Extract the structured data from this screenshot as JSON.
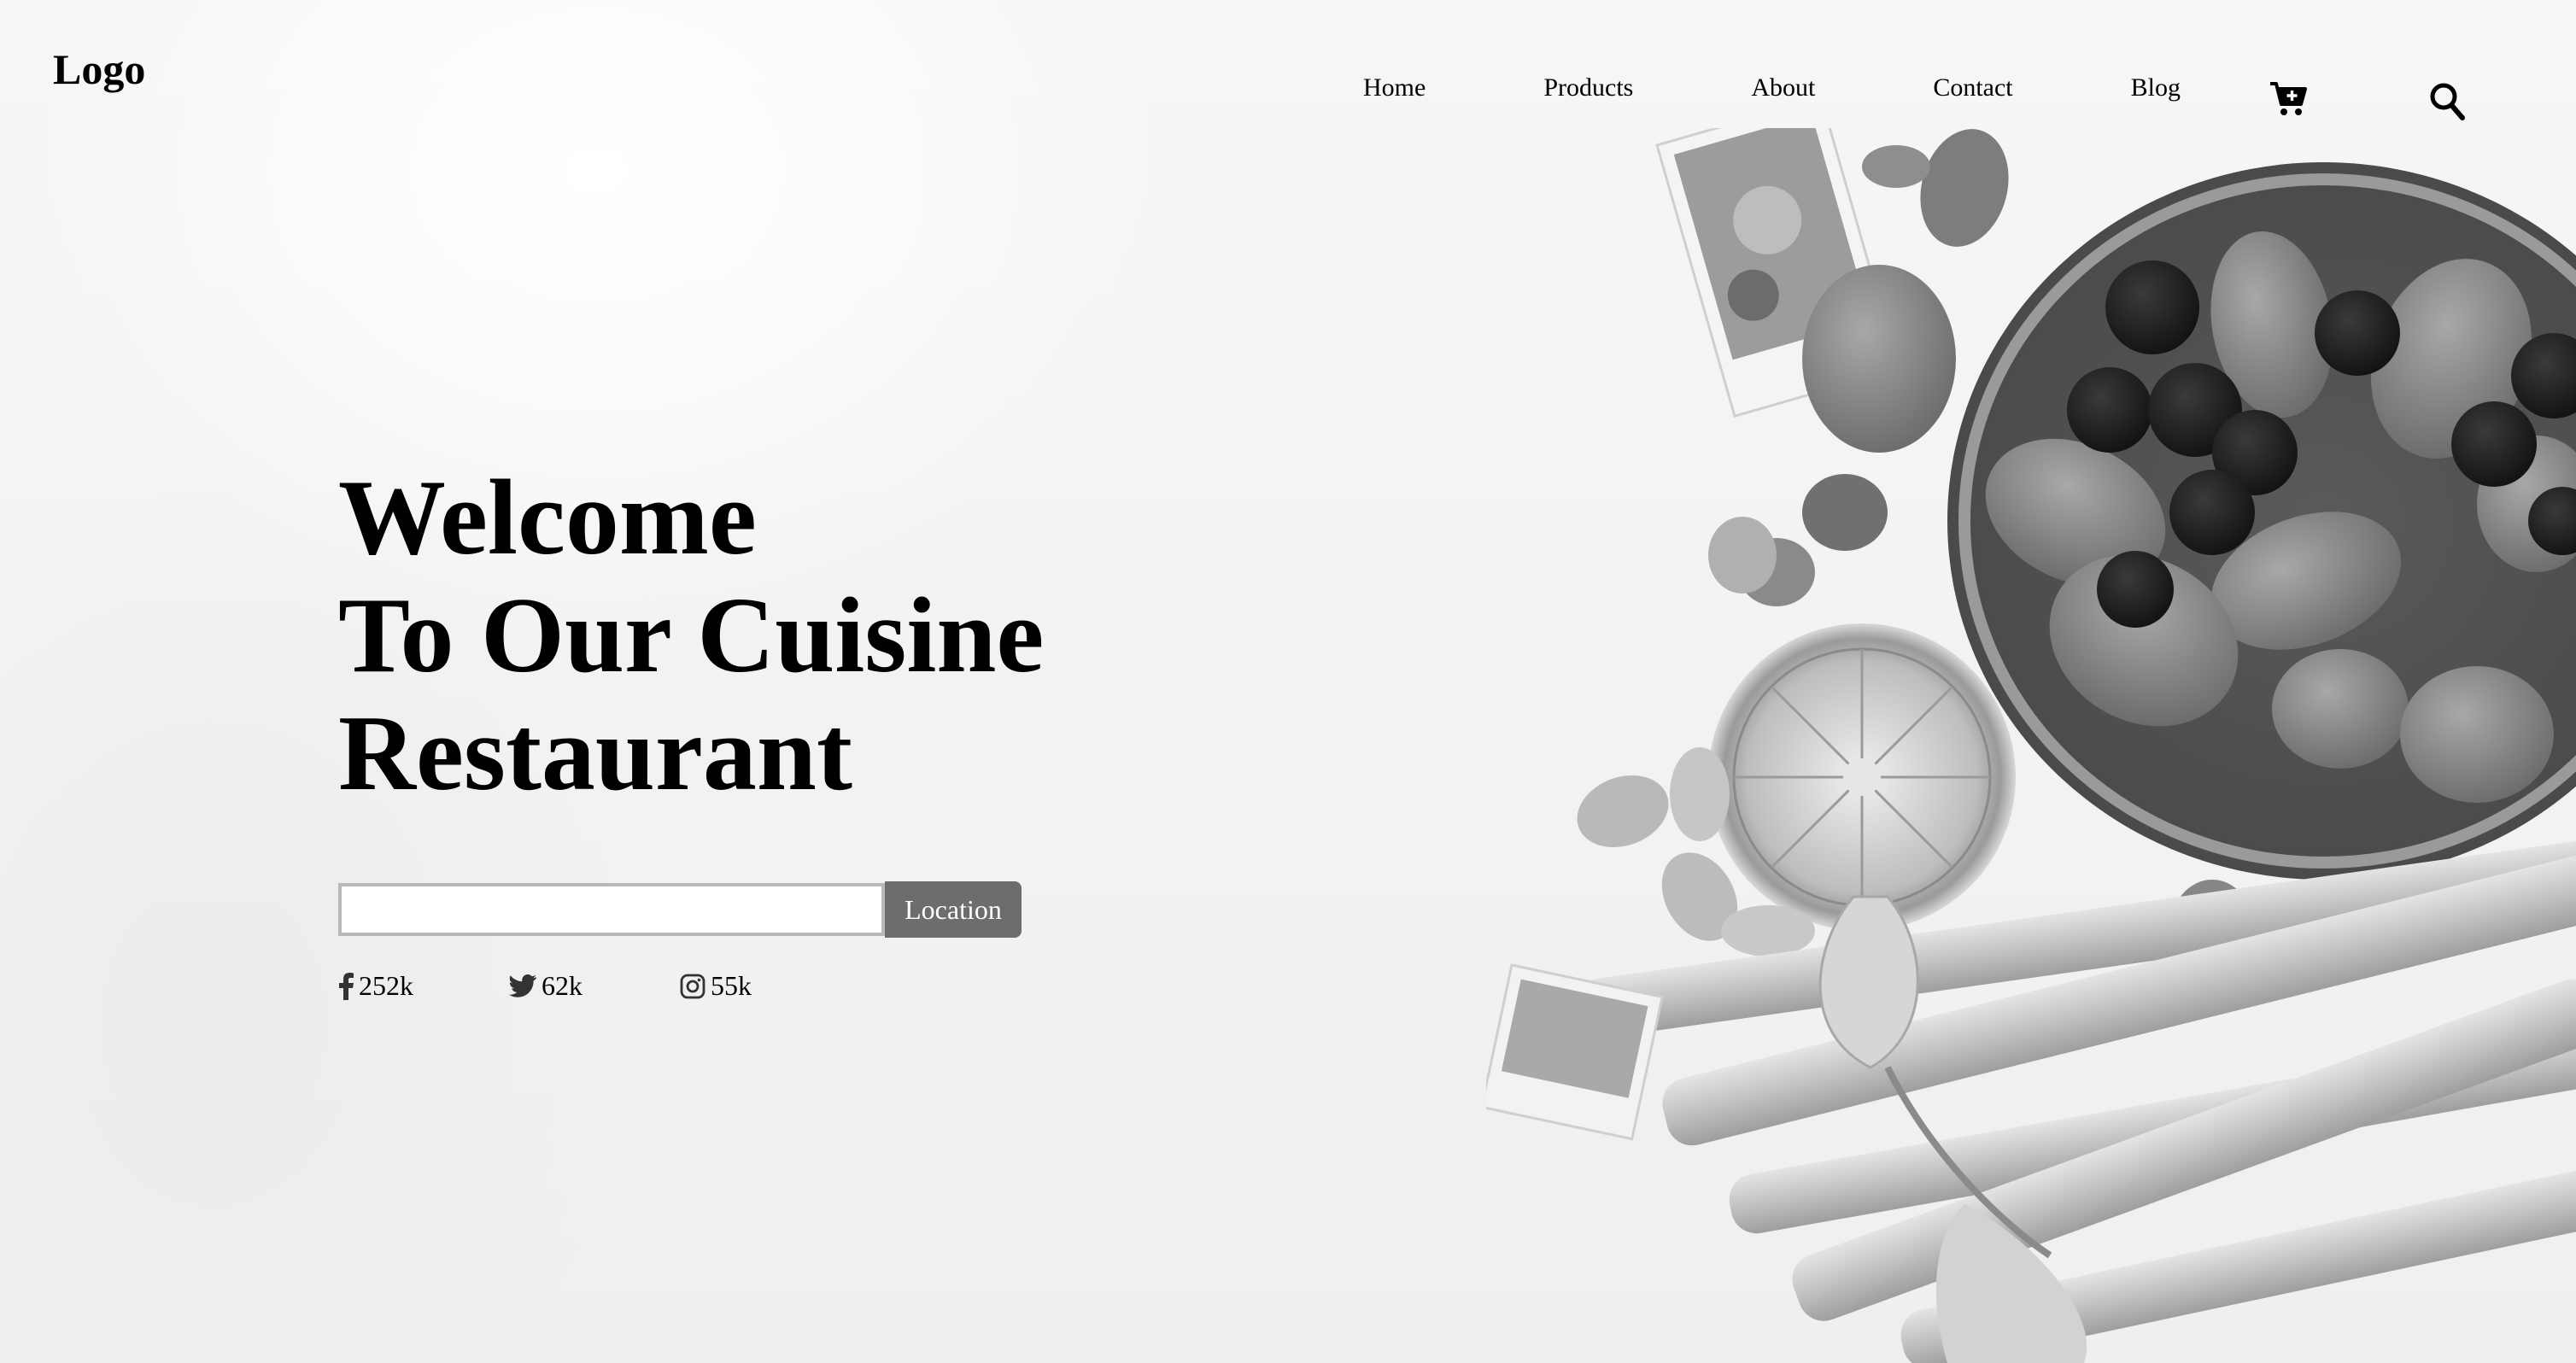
{
  "header": {
    "logo": "Logo",
    "nav": [
      "Home",
      "Products",
      "About",
      "Contact",
      "Blog"
    ],
    "icons": [
      "cart-icon",
      "search-icon"
    ]
  },
  "hero": {
    "title_lines": [
      "Welcome",
      "To Our Cuisine",
      "Restaurant"
    ]
  },
  "search": {
    "value": "",
    "placeholder": "",
    "button_label": "Location"
  },
  "social": [
    {
      "icon": "facebook-icon",
      "count": "252k"
    },
    {
      "icon": "twitter-icon",
      "count": "62k"
    },
    {
      "icon": "instagram-icon",
      "count": "55k"
    }
  ],
  "colors": {
    "text": "#000000",
    "button_bg": "#6d6d6d",
    "button_text": "#ffffff",
    "input_border": "#b8b8b8"
  }
}
